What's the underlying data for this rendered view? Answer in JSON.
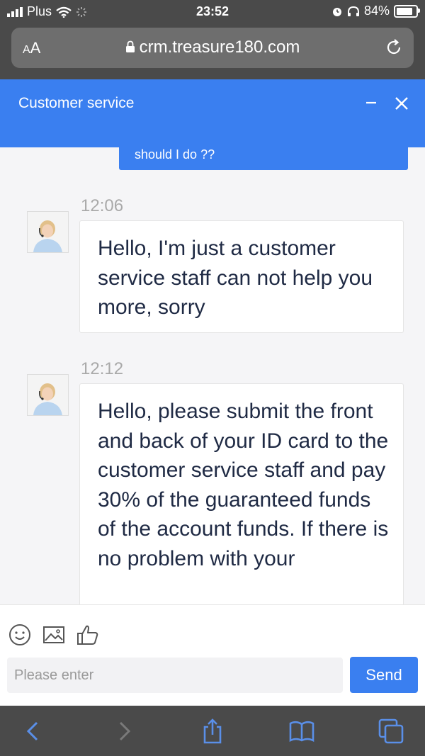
{
  "status_bar": {
    "carrier": "Plus",
    "time": "23:52",
    "battery_percent_label": "84%",
    "battery_level": 0.84
  },
  "browser": {
    "text_size_label_small": "A",
    "text_size_label_large": "A",
    "url": "crm.treasure180.com"
  },
  "widget": {
    "title": "Customer service"
  },
  "messages": [
    {
      "direction": "outgoing",
      "text": "should I do ??"
    },
    {
      "direction": "incoming",
      "time": "12:06",
      "text": "Hello, I'm just a customer service staff can not help you more, sorry"
    },
    {
      "direction": "incoming",
      "time": "12:12",
      "text": "Hello, please submit the front and back of your ID card to the customer service staff and pay 30% of the guaranteed funds of the account funds. If there is no problem with your"
    }
  ],
  "composer": {
    "placeholder": "Please enter",
    "value": "",
    "send_label": "Send"
  },
  "colors": {
    "accent": "#3a7ff0",
    "chrome": "#4a4a4a",
    "text": "#1f2a44",
    "timestamp": "#a9a9a9"
  },
  "icons": [
    "signal-icon",
    "wifi-icon",
    "brightness-icon",
    "alarm-icon",
    "headphones-icon",
    "battery-icon",
    "lock-icon",
    "reload-icon",
    "minimize-icon",
    "close-icon",
    "emoji-icon",
    "image-icon",
    "thumbs-up-icon",
    "back-icon",
    "forward-icon",
    "share-icon",
    "bookmarks-icon",
    "tabs-icon"
  ]
}
